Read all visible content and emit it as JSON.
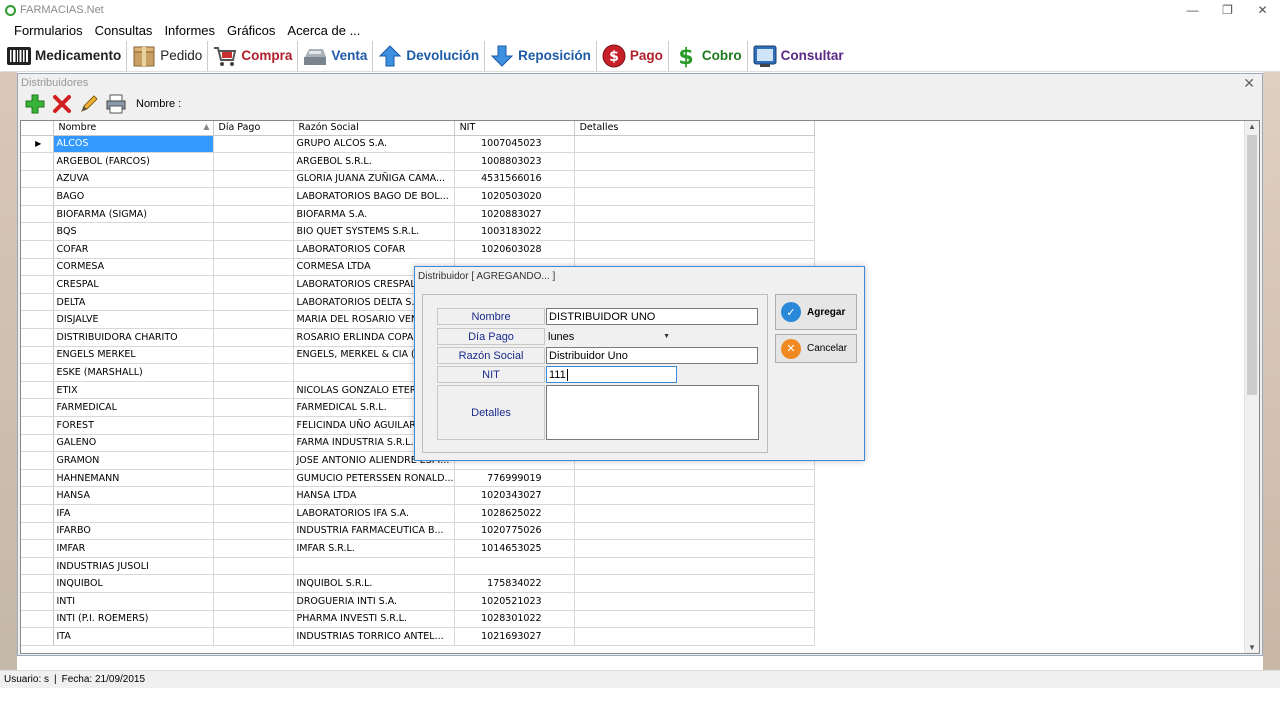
{
  "app": {
    "title": "FARMACIAS.Net",
    "controls": [
      "—",
      "❐",
      "✕"
    ]
  },
  "menu": [
    "Formularios",
    "Consultas",
    "Informes",
    "Gráficos",
    "Acerca de ..."
  ],
  "toolbar": {
    "medicamento": "Medicamento",
    "pedido": "Pedido",
    "compra": "Compra",
    "venta": "Venta",
    "devolucion": "Devolución",
    "reposicion": "Reposición",
    "pago": "Pago",
    "cobro": "Cobro",
    "consultar": "Consultar"
  },
  "window": {
    "title": "Distribuidores",
    "close": "✕",
    "nombre_label": "Nombre :",
    "columns": [
      "Nombre",
      "Día Pago",
      "Razón Social",
      "NIT",
      "Detalles"
    ],
    "rows": [
      [
        "ALCOS",
        "",
        "GRUPO ALCOS S.A.",
        "1007045023",
        ""
      ],
      [
        "ARGEBOL (FARCOS)",
        "",
        "ARGEBOL S.R.L.",
        "1008803023",
        ""
      ],
      [
        "AZUVA",
        "",
        "GLORIA JUANA ZUÑIGA CAMA...",
        "4531566016",
        ""
      ],
      [
        "BAGO",
        "",
        "LABORATORIOS BAGO DE BOL...",
        "1020503020",
        ""
      ],
      [
        "BIOFARMA (SIGMA)",
        "",
        "BIOFARMA S.A.",
        "1020883027",
        ""
      ],
      [
        "BQS",
        "",
        "BIO QUET SYSTEMS S.R.L.",
        "1003183022",
        ""
      ],
      [
        "COFAR",
        "",
        "LABORATORIOS COFAR",
        "1020603028",
        ""
      ],
      [
        "CORMESA",
        "",
        "CORMESA LTDA",
        "",
        ""
      ],
      [
        "CRESPAL",
        "",
        "LABORATORIOS CRESPAL",
        "",
        ""
      ],
      [
        "DELTA",
        "",
        "LABORATORIOS DELTA S.A.",
        "",
        ""
      ],
      [
        "DISJALVE",
        "",
        "MARIA DEL ROSARIO VEN",
        "",
        ""
      ],
      [
        "DISTRIBUIDORA CHARITO",
        "",
        "ROSARIO ERLINDA COPA",
        "",
        ""
      ],
      [
        "ENGELS MERKEL",
        "",
        "ENGELS, MERKEL & CIA (E",
        "",
        ""
      ],
      [
        "ESKE (MARSHALL)",
        "",
        "",
        "",
        ""
      ],
      [
        "ETIX",
        "",
        "NICOLAS GONZALO ETER",
        "",
        ""
      ],
      [
        "FARMEDICAL",
        "",
        "FARMEDICAL S.R.L.",
        "",
        ""
      ],
      [
        "FOREST",
        "",
        "FELICINDA UÑO AGUILAR",
        "",
        ""
      ],
      [
        "GALENO",
        "",
        "FARMA INDUSTRIA S.R.L.",
        "",
        ""
      ],
      [
        "GRAMON",
        "",
        "JOSE ANTONIO ALIENDRE ESPI...",
        "",
        ""
      ],
      [
        "HAHNEMANN",
        "",
        "GUMUCIO PETERSSEN RONALD...",
        "776999019",
        ""
      ],
      [
        "HANSA",
        "",
        "HANSA LTDA",
        "1020343027",
        ""
      ],
      [
        "IFA",
        "",
        "LABORATORIOS IFA S.A.",
        "1028625022",
        ""
      ],
      [
        "IFARBO",
        "",
        "INDUSTRIA FARMACEUTICA B...",
        "1020775026",
        ""
      ],
      [
        "IMFAR",
        "",
        "IMFAR S.R.L.",
        "1014653025",
        ""
      ],
      [
        "INDUSTRIAS JUSOLI",
        "",
        "",
        "",
        ""
      ],
      [
        "INQUIBOL",
        "",
        "INQUIBOL S.R.L.",
        "175834022",
        ""
      ],
      [
        "INTI",
        "",
        "DROGUERIA INTI S.A.",
        "1020521023",
        ""
      ],
      [
        "INTI (P.I. ROEMERS)",
        "",
        "PHARMA INVESTI S.R.L.",
        "1028301022",
        ""
      ],
      [
        "ITA",
        "",
        "INDUSTRIAS TORRICO ANTEL...",
        "1021693027",
        ""
      ]
    ]
  },
  "dialog": {
    "title": "Distribuidor [ AGREGANDO... ]",
    "labels": {
      "nombre": "Nombre",
      "dia_pago": "Día Pago",
      "razon_social": "Razón Social",
      "nit": "NIT",
      "detalles": "Detalles"
    },
    "values": {
      "nombre": "DISTRIBUIDOR UNO",
      "dia_pago": "lunes",
      "razon_social": "Distribuidor Uno",
      "nit": "111",
      "detalles": ""
    },
    "agregar": "Agregar",
    "cancelar": "Cancelar"
  },
  "status": {
    "usuario": "Usuario: s",
    "sep": "|",
    "fecha": "Fecha: 21/09/2015"
  }
}
